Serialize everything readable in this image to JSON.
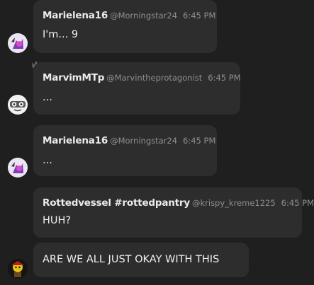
{
  "messages": [
    {
      "username": "Marielena16",
      "handle": "@Morningstar24",
      "time": "6:45 PM",
      "text": "I'm... 9",
      "avatar_icon": "sparkle-character-avatar-icon"
    },
    {
      "username": "MarvimMTp",
      "handle": "@Marvintheprotagonist",
      "time": "6:45 PM",
      "text": "...",
      "avatar_icon": "goggles-character-avatar-icon",
      "badge_icon": "crown-icon"
    },
    {
      "username": "Marielena16",
      "handle": "@Morningstar24",
      "time": "6:45 PM",
      "text": "...",
      "avatar_icon": "sparkle-character-avatar-icon"
    },
    {
      "username": "Rottedvessel #rottedpantry",
      "handle": "@krispy_kreme1225",
      "time": "6:45 PM",
      "text": "HUH?"
    },
    {
      "text": "ARE WE ALL JUST OKAY WITH THIS",
      "avatar_icon": "yellow-character-avatar-icon"
    }
  ],
  "colors": {
    "background": "#1f1f1f",
    "bubble": "#2d2d2d",
    "username": "#ececec",
    "meta": "#8f8f8f",
    "text": "#f0f0f0",
    "crown": "#6a6a6a"
  }
}
